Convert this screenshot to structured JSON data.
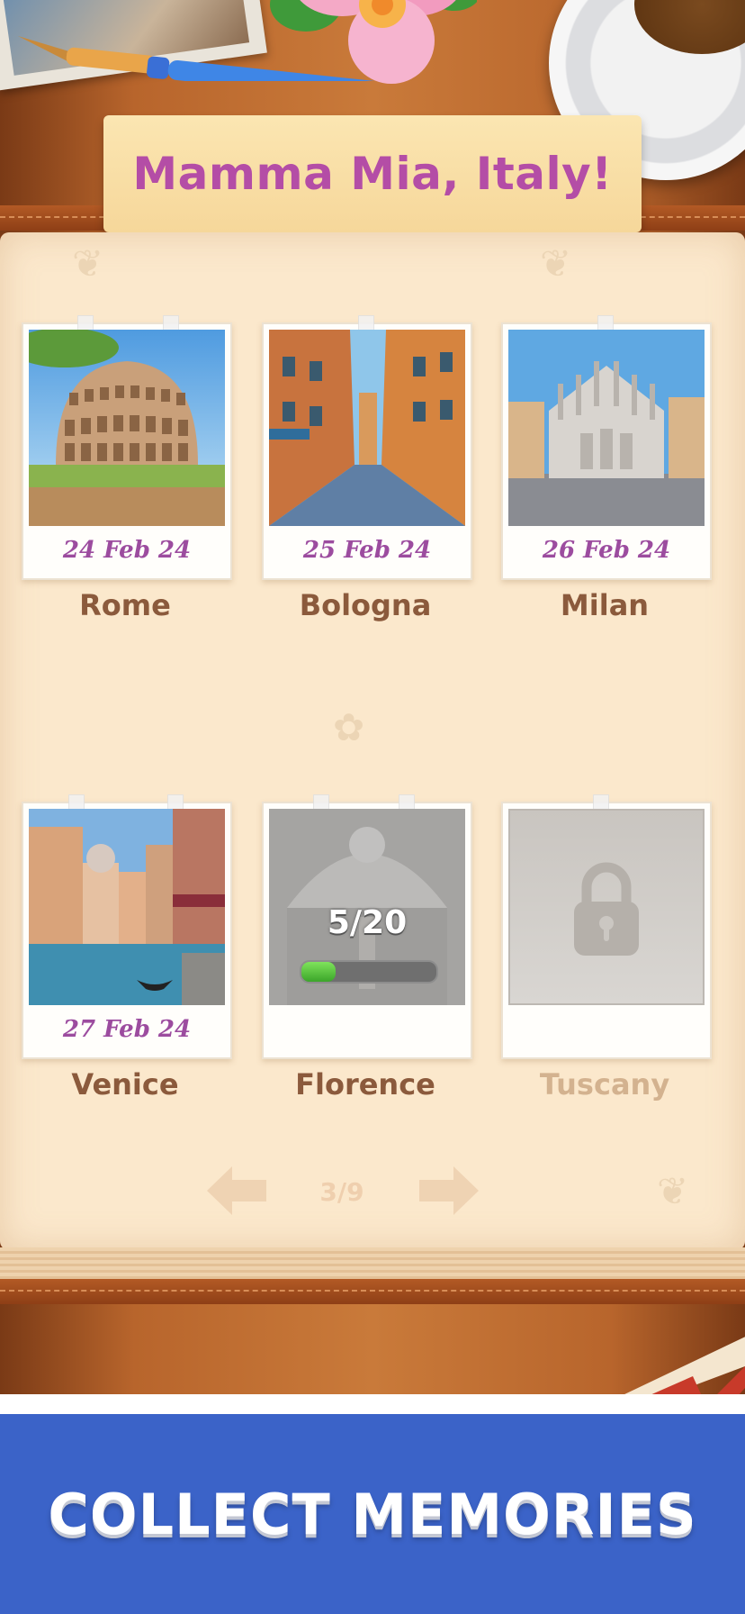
{
  "album": {
    "title": "Mamma Mia, Italy!",
    "cards": [
      {
        "city": "Rome",
        "date": "24 Feb 24",
        "state": "completed"
      },
      {
        "city": "Bologna",
        "date": "25 Feb 24",
        "state": "completed"
      },
      {
        "city": "Milan",
        "date": "26 Feb 24",
        "state": "completed"
      },
      {
        "city": "Venice",
        "date": "27 Feb 24",
        "state": "completed"
      },
      {
        "city": "Florence",
        "state": "in-progress",
        "progress_label": "5/20",
        "progress_value": 0.25
      },
      {
        "city": "Tuscany",
        "state": "locked"
      }
    ],
    "pagination": {
      "label": "3/9"
    }
  },
  "promo": {
    "text": "COLLECT MEMORIES"
  },
  "colors": {
    "title": "#b44da6",
    "date": "#9c4c9f",
    "city": "#8b5a3c",
    "city_locked": "#d3b28f",
    "promo_bg": "#3b63c8",
    "progress_fill": "#49b834"
  },
  "icons": [
    "fountain-pen-icon",
    "plumeria-flower-icon",
    "coffee-cup-icon",
    "lock-icon",
    "arrow-left-icon",
    "arrow-right-icon"
  ]
}
